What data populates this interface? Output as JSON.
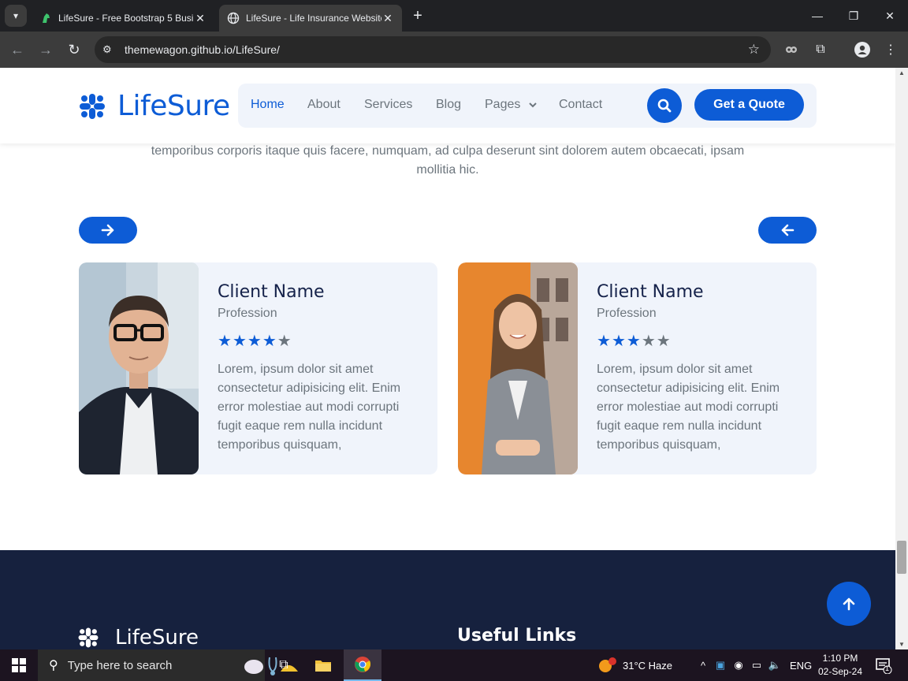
{
  "browser": {
    "tabs": [
      {
        "title": "LifeSure - Free Bootstrap 5 Busi",
        "active": false
      },
      {
        "title": "LifeSure - Life Insurance Website",
        "active": true
      }
    ],
    "url": "themewagon.github.io/LifeSure/"
  },
  "site": {
    "brand": "LifeSure",
    "nav": [
      {
        "label": "Home",
        "active": true
      },
      {
        "label": "About",
        "active": false
      },
      {
        "label": "Services",
        "active": false
      },
      {
        "label": "Blog",
        "active": false
      },
      {
        "label": "Pages",
        "active": false,
        "dropdown": true
      },
      {
        "label": "Contact",
        "active": false
      }
    ],
    "cta": "Get a Quote",
    "accent": "#0d5cd6"
  },
  "section": {
    "intro_text": "temporibus corporis itaque quis facere, numquam, ad culpa deserunt sint dolorem autem obcaecati, ipsam mollitia hic."
  },
  "testimonials": [
    {
      "name": "Client Name",
      "profession": "Profession",
      "rating": 4,
      "text": "Lorem, ipsum dolor sit amet consectetur adipisicing elit. Enim error molestiae aut modi corrupti fugit eaque rem nulla incidunt temporibus quisquam,"
    },
    {
      "name": "Client Name",
      "profession": "Profession",
      "rating": 3,
      "text": "Lorem, ipsum dolor sit amet consectetur adipisicing elit. Enim error molestiae aut modi corrupti fugit eaque rem nulla incidunt temporibus quisquam,"
    }
  ],
  "footer": {
    "brand": "LifeSure",
    "heading": "Useful Links",
    "background": "#16213e"
  },
  "taskbar": {
    "search_placeholder": "Type here to search",
    "weather": "31°C  Haze",
    "language": "ENG",
    "time": "1:10 PM",
    "date": "02-Sep-24",
    "notification_count": "1"
  }
}
